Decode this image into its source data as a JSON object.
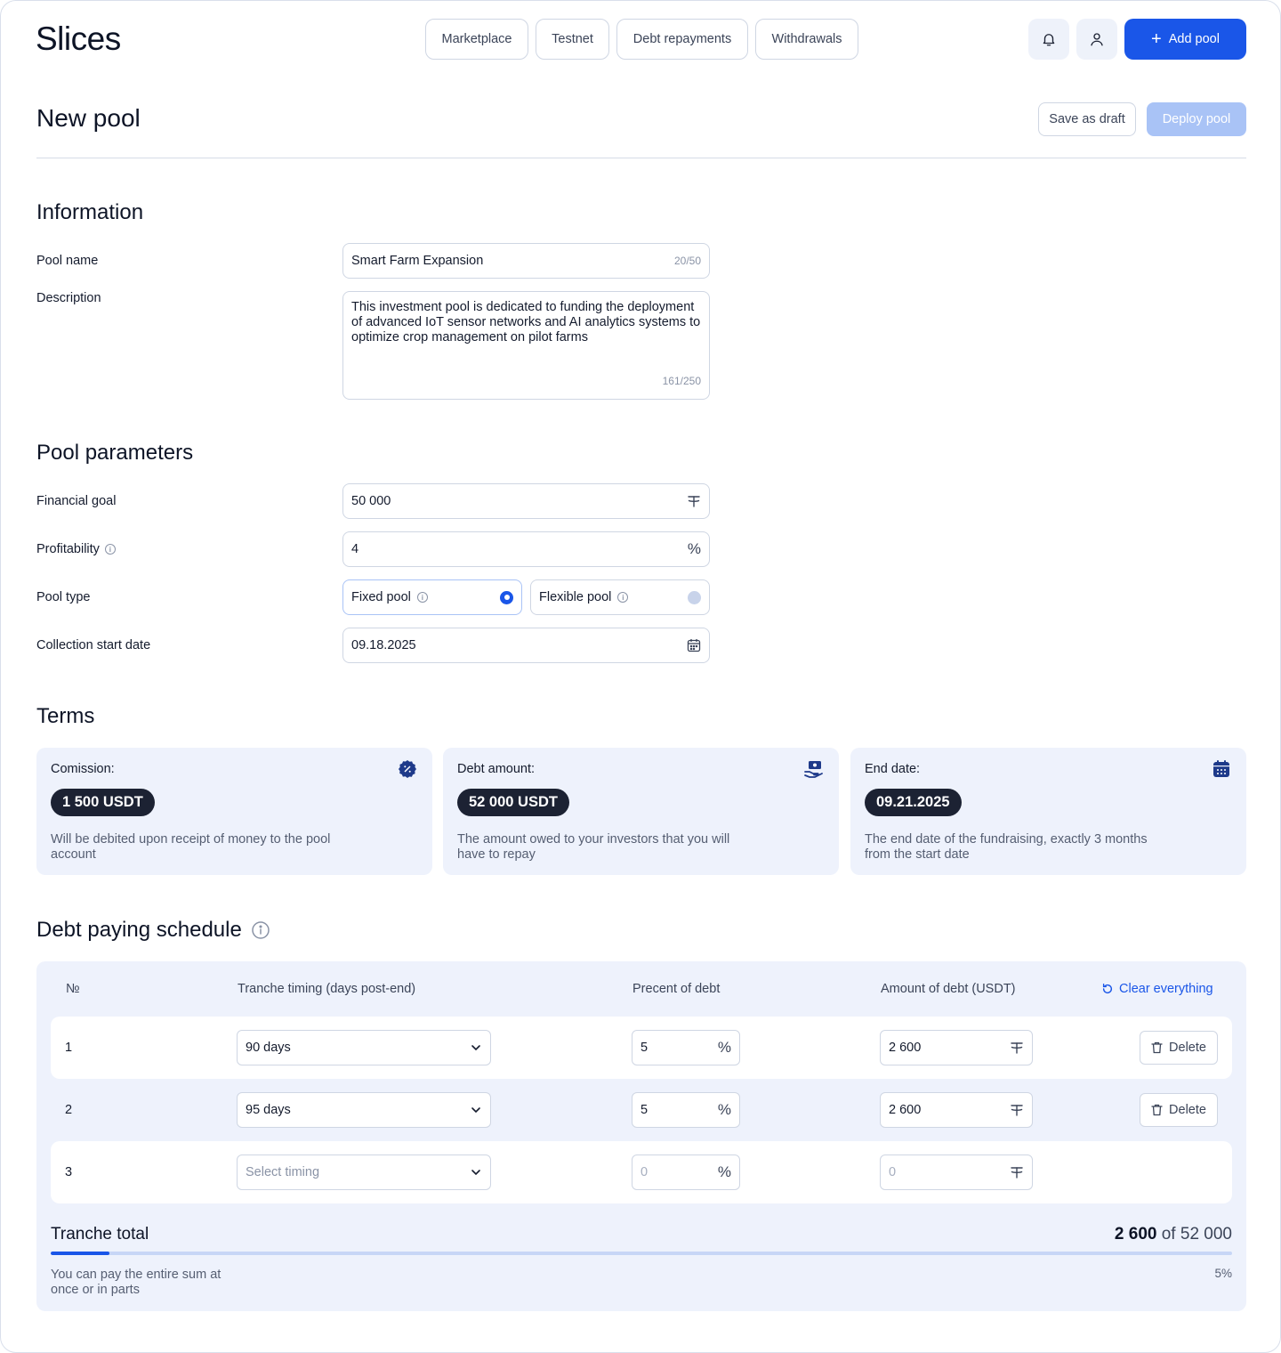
{
  "app": {
    "logo": "Slices"
  },
  "nav": {
    "items": [
      "Marketplace",
      "Testnet",
      "Debt repayments",
      "Withdrawals"
    ]
  },
  "header": {
    "add_pool_label": "Add pool",
    "icons": [
      "bell-icon",
      "user-icon"
    ]
  },
  "page": {
    "title": "New pool",
    "save_draft_label": "Save as draft",
    "deploy_label": "Deploy pool"
  },
  "information": {
    "title": "Information",
    "pool_name_label": "Pool name",
    "pool_name_value": "Smart Farm Expansion",
    "pool_name_counter": "20/50",
    "description_label": "Description",
    "description_value": "This investment pool is dedicated to funding the deployment of advanced IoT sensor networks and AI analytics systems to optimize crop management on pilot farms",
    "description_counter": "161/250"
  },
  "parameters": {
    "title": "Pool parameters",
    "financial_goal_label": "Financial goal",
    "financial_goal_value": "50 000",
    "profitability_label": "Profitability",
    "profitability_value": "4",
    "pool_type_label": "Pool type",
    "fixed_label": "Fixed pool",
    "flexible_label": "Flexible pool",
    "selected_type": "fixed",
    "start_date_label": "Collection start date",
    "start_date_value": "09.18.2025"
  },
  "terms": {
    "title": "Terms",
    "cards": [
      {
        "label": "Comission:",
        "value": "1 500 USDT",
        "text": "Will be debited upon receipt of money to the pool account",
        "icon": "discount-badge-icon"
      },
      {
        "label": "Debt amount:",
        "value": "52 000 USDT",
        "text": "The amount owed to your investors that you will have to repay",
        "icon": "money-hand-icon"
      },
      {
        "label": "End date:",
        "value": "09.21.2025",
        "text": "The end date of the fundraising, exactly 3 months from the start date",
        "icon": "calendar-icon"
      }
    ]
  },
  "schedule": {
    "title": "Debt paying schedule",
    "headers": {
      "num": "№",
      "timing": "Tranche timing (days post-end)",
      "percent": "Precent of debt",
      "amount": "Amount of debt (USDT)"
    },
    "clear_label": "Clear everything",
    "delete_label": "Delete",
    "rows": [
      {
        "num": "1",
        "timing": "90 days",
        "percent": "5",
        "amount": "2 600"
      },
      {
        "num": "2",
        "timing": "95 days",
        "percent": "5",
        "amount": "2 600"
      },
      {
        "num": "3",
        "timing": "Select timing",
        "percent": "0",
        "amount": "0"
      }
    ],
    "total_label": "Tranche total",
    "total_value": "2 600",
    "total_of": "of",
    "total_goal": "52 000",
    "progress_fraction": 0.05,
    "progress_label": "5%",
    "hint": "You can pay the entire sum at once or in parts"
  },
  "colors": {
    "accent": "#1a56e8",
    "card_bg": "#eef2fc",
    "pill": "#1c2233"
  }
}
